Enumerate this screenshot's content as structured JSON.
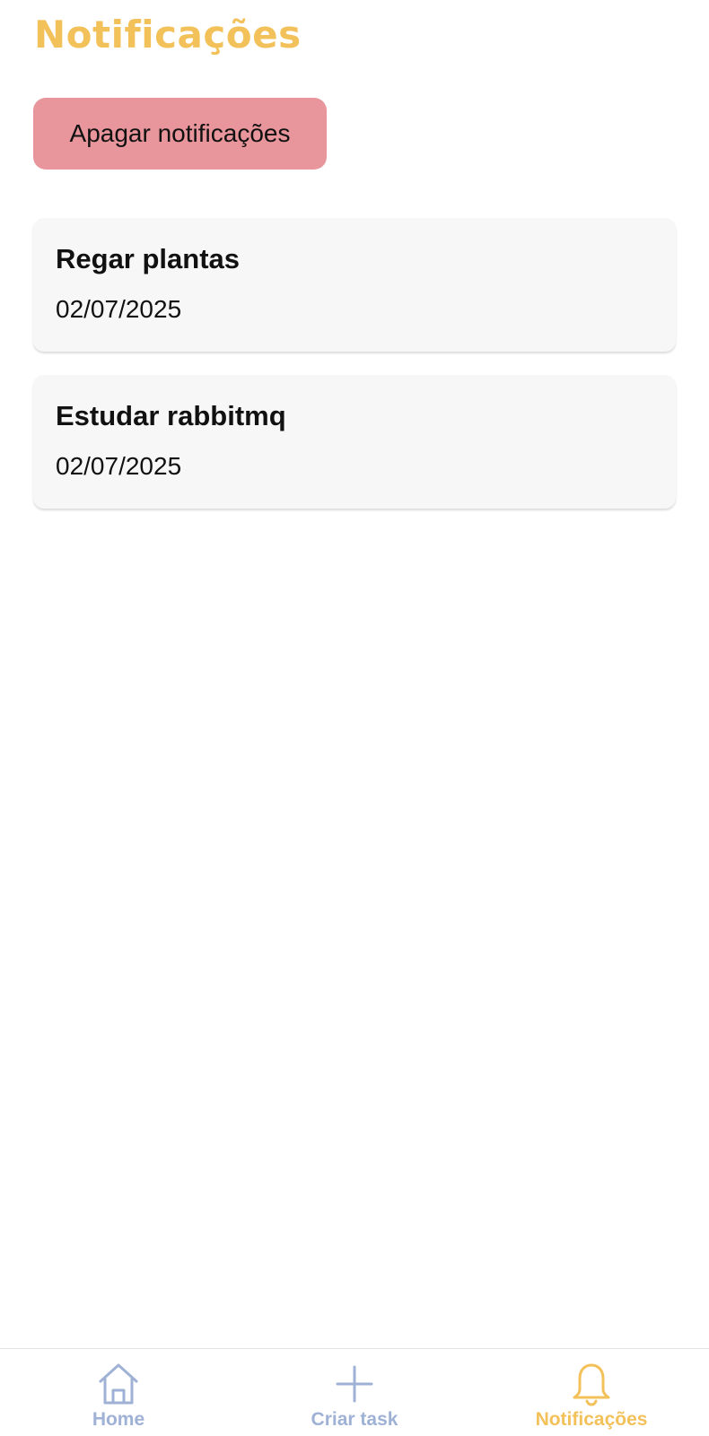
{
  "header": {
    "title": "Notificações"
  },
  "actions": {
    "clear_label": "Apagar notificações"
  },
  "notifications": [
    {
      "title": "Regar plantas",
      "date": "02/07/2025"
    },
    {
      "title": "Estudar rabbitmq",
      "date": "02/07/2025"
    }
  ],
  "bottom_nav": {
    "items": [
      {
        "label": "Home",
        "icon": "home-icon",
        "active": false
      },
      {
        "label": "Criar task",
        "icon": "plus-icon",
        "active": false
      },
      {
        "label": "Notificações",
        "icon": "bell-icon",
        "active": true
      }
    ]
  },
  "colors": {
    "accent": "#f3c15a",
    "inactive_nav": "#9fb2d6",
    "danger_button": "#e8959b",
    "card_background": "#f7f7f7"
  }
}
